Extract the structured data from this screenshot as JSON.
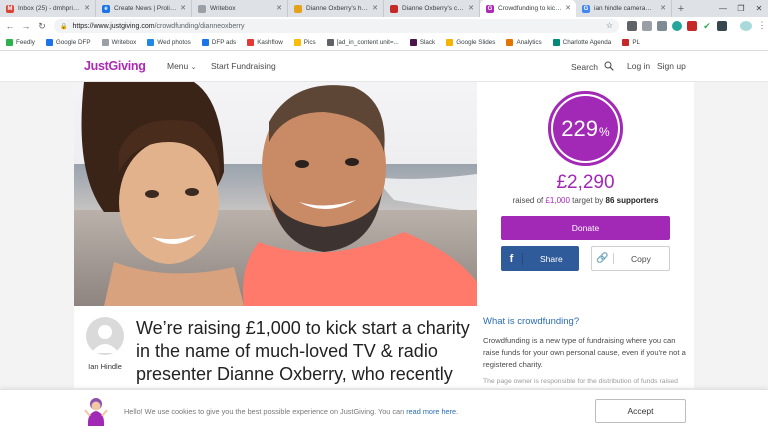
{
  "browser": {
    "tabs": [
      {
        "title": "Inbox (25) - dmhprior@...",
        "color": "#db4437",
        "glyph": "M",
        "active": false
      },
      {
        "title": "Create News | Prolific N...",
        "color": "#1a73e8",
        "glyph": "e",
        "active": false
      },
      {
        "title": "Writebox",
        "color": "#9aa0a6",
        "glyph": "",
        "active": false
      },
      {
        "title": "Dianne Oxberry's husba...",
        "color": "#e3a21a",
        "glyph": "",
        "active": false
      },
      {
        "title": "Dianne Oxberry's cause...",
        "color": "#c62828",
        "glyph": "",
        "active": false
      },
      {
        "title": "Crowdfunding to kick st...",
        "color": "#ad29b6",
        "glyph": "G",
        "active": true
      },
      {
        "title": "ian hindle cameraman -...",
        "color": "#4285f4",
        "glyph": "G",
        "active": false
      }
    ],
    "url_host": "https://www.justgiving.com",
    "url_path": "/crowdfunding/dianneoxberry",
    "bookmarks": [
      {
        "label": "Feedly",
        "color": "#2bb24c"
      },
      {
        "label": "Google DFP",
        "color": "#1a73e8"
      },
      {
        "label": "Writebox",
        "color": "#9aa0a6"
      },
      {
        "label": "Wed photos",
        "color": "#1e88e5"
      },
      {
        "label": "DFP ads",
        "color": "#1a73e8"
      },
      {
        "label": "Kashflow",
        "color": "#e53935"
      },
      {
        "label": "Pics",
        "color": "#fbbc04"
      },
      {
        "label": "[ad_in_content unit=...",
        "color": "#5f6368"
      },
      {
        "label": "Slack",
        "color": "#4a154b"
      },
      {
        "label": "Google Slides",
        "color": "#f4b400"
      },
      {
        "label": "Analytics",
        "color": "#e37400"
      },
      {
        "label": "Charlotte Agenda",
        "color": "#00897b"
      },
      {
        "label": "PL",
        "color": "#c62828"
      }
    ]
  },
  "header": {
    "logo": "JustGiving",
    "menu_label": "Menu",
    "start_label": "Start Fundraising",
    "search_label": "Search",
    "login_label": "Log in",
    "signup_label": "Sign up"
  },
  "campaign": {
    "percent": "229",
    "percent_sign": "%",
    "raised": "£2,290",
    "target_prefix": "raised of ",
    "target_amount": "£1,000",
    "target_mid": " target by ",
    "supporters": "86 supporters",
    "donate_label": "Donate",
    "share_label": "Share",
    "copy_label": "Copy",
    "owner_name": "Ian Hindle",
    "headline": "We’re raising £1,000 to kick start a charity in the name of much-loved TV & radio presenter Dianne Oxberry, who recently"
  },
  "crowdfunding_info": {
    "title": "What is crowdfunding?",
    "body": "Crowdfunding is a new type of fundraising where you can raise funds for your own personal cause, even if you're not a registered charity.",
    "fade": "The page owner is responsible for the distribution of funds raised"
  },
  "cookie": {
    "text": "Hello! We use cookies to give you the best possible experience on JustGiving. You can ",
    "link": "read more here.",
    "accept_label": "Accept"
  },
  "colors": {
    "brand_purple": "#a228b6",
    "facebook_blue": "#2f5b9a",
    "link_blue": "#2b6cb0"
  }
}
